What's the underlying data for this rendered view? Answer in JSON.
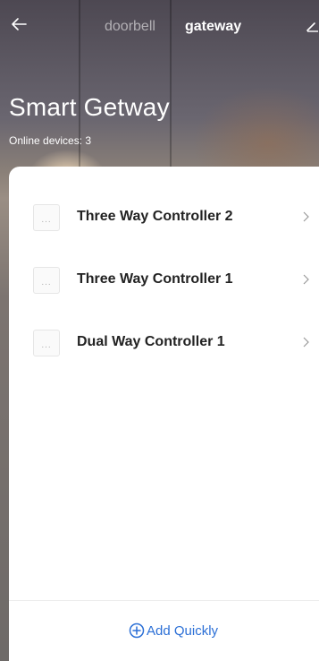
{
  "topbar": {
    "back_icon": "arrow-left-icon",
    "tabs": [
      {
        "label": "doorbell",
        "active": false
      },
      {
        "label": "gateway",
        "active": true
      }
    ],
    "edit_icon": "pencil-icon"
  },
  "hero": {
    "title": "Smart Getway",
    "subtitle": "Online devices: 3"
  },
  "devices": [
    {
      "name": "Three Way Controller 2",
      "icon": "switch-panel-icon",
      "chevron": ">"
    },
    {
      "name": "Three Way Controller 1",
      "icon": "switch-panel-icon",
      "chevron": ">"
    },
    {
      "name": "Dual Way Controller 1",
      "icon": "switch-panel-icon",
      "chevron": ">"
    }
  ],
  "footer": {
    "add_label": "Add Quickly",
    "add_icon": "plus-circle-icon"
  },
  "colors": {
    "accent": "#2b6fd6",
    "text_primary": "#222222",
    "panel_bg": "#ffffff"
  }
}
